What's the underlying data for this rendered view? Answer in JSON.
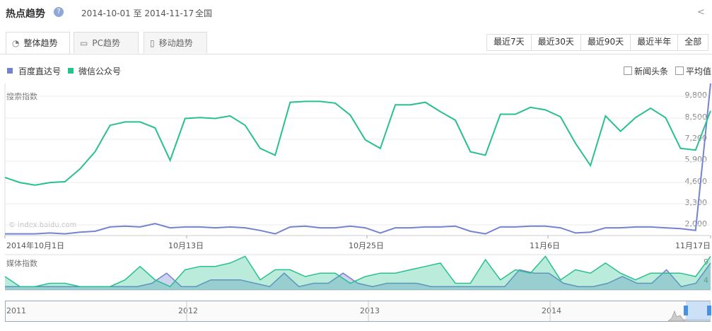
{
  "header": {
    "title": "热点趋势",
    "help": "?",
    "date_range": "2014-10-01 至 2014-11-17",
    "region": "全国",
    "share_icon": "share-icon"
  },
  "tabs": [
    {
      "label": "整体趋势",
      "icon": "pie-icon",
      "active": true
    },
    {
      "label": "PC趋势",
      "icon": "monitor-icon",
      "active": false
    },
    {
      "label": "移动趋势",
      "icon": "mobile-icon",
      "active": false
    }
  ],
  "ranges": [
    "最近7天",
    "最近30天",
    "最近90天",
    "最近半年",
    "全部"
  ],
  "legend": {
    "series": [
      {
        "label": "百度直达号",
        "color": "#7483d0"
      },
      {
        "label": "微信公众号",
        "color": "#27c08e"
      }
    ],
    "options": [
      "新闻头条",
      "平均值"
    ]
  },
  "search_chart": {
    "label": "搜索指数",
    "yticks": [
      "9,800",
      "8,500",
      "7,200",
      "5,900",
      "4,600",
      "3,300",
      "2,000"
    ],
    "watermark": "© index.baidu.com",
    "xticks": [
      "2014年10月1日",
      "10月13日",
      "10月25日",
      "11月6日",
      "11月17日"
    ]
  },
  "media_chart": {
    "label": "媒体指数",
    "yticks": [
      "9",
      "4"
    ]
  },
  "navigator": {
    "years": [
      "2011",
      "2012",
      "2013",
      "2014"
    ]
  },
  "chart_data": {
    "type": "line",
    "x": [
      "2014-10-01",
      "2014-10-02",
      "2014-10-03",
      "2014-10-04",
      "2014-10-05",
      "2014-10-06",
      "2014-10-07",
      "2014-10-08",
      "2014-10-09",
      "2014-10-10",
      "2014-10-11",
      "2014-10-12",
      "2014-10-13",
      "2014-10-14",
      "2014-10-15",
      "2014-10-16",
      "2014-10-17",
      "2014-10-18",
      "2014-10-19",
      "2014-10-20",
      "2014-10-21",
      "2014-10-22",
      "2014-10-23",
      "2014-10-24",
      "2014-10-25",
      "2014-10-26",
      "2014-10-27",
      "2014-10-28",
      "2014-10-29",
      "2014-10-30",
      "2014-10-31",
      "2014-11-01",
      "2014-11-02",
      "2014-11-03",
      "2014-11-04",
      "2014-11-05",
      "2014-11-06",
      "2014-11-07",
      "2014-11-08",
      "2014-11-09",
      "2014-11-10",
      "2014-11-11",
      "2014-11-12",
      "2014-11-13",
      "2014-11-14",
      "2014-11-15",
      "2014-11-16",
      "2014-11-17"
    ],
    "series": [
      {
        "name": "百度直达号",
        "values": [
          1500,
          1500,
          1500,
          1550,
          1500,
          1600,
          1650,
          1900,
          1950,
          1900,
          2100,
          1850,
          1900,
          1900,
          1850,
          1900,
          1850,
          1700,
          1500,
          1900,
          1950,
          1850,
          1850,
          1950,
          1850,
          1550,
          1850,
          1850,
          1900,
          1900,
          1950,
          1650,
          1500,
          1900,
          1900,
          1950,
          1950,
          1850,
          1550,
          1600,
          1850,
          1850,
          1900,
          1900,
          1850,
          1800,
          1700,
          10300
        ]
      },
      {
        "name": "微信公众号",
        "values": [
          4800,
          4500,
          4350,
          4500,
          4550,
          5300,
          6300,
          7850,
          8050,
          8050,
          7700,
          5800,
          8250,
          8300,
          8250,
          8400,
          7850,
          6500,
          6100,
          9200,
          9250,
          9250,
          9150,
          8450,
          7000,
          6500,
          9050,
          9050,
          9200,
          8650,
          8150,
          6300,
          6100,
          8500,
          8500,
          8900,
          8750,
          8350,
          6800,
          5500,
          8400,
          7500,
          8300,
          8850,
          8300,
          6500,
          6400,
          8700
        ]
      }
    ],
    "ylim": [
      1400,
      10300
    ],
    "media": {
      "series": [
        {
          "name": "百度直达号",
          "values": [
            1,
            1,
            1,
            1,
            1,
            1,
            1,
            1,
            1,
            1,
            2,
            5,
            1,
            1,
            3,
            3,
            3,
            2,
            1,
            5,
            1,
            2,
            2,
            5,
            2,
            1,
            2,
            2,
            2,
            1,
            1,
            1,
            1,
            1,
            1,
            6,
            5,
            5,
            2,
            1,
            1,
            2,
            4,
            2,
            2,
            6,
            1,
            2,
            8
          ]
        },
        {
          "name": "微信公众号",
          "values": [
            4,
            1,
            1,
            2,
            2,
            1,
            1,
            1,
            3,
            7,
            3,
            1,
            6,
            7,
            7,
            8,
            10,
            3,
            6,
            6,
            4,
            5,
            5,
            2,
            4,
            5,
            5,
            6,
            7,
            8,
            2,
            2,
            9,
            3,
            6,
            5,
            10,
            3,
            6,
            5,
            8,
            5,
            3,
            5,
            5,
            5,
            4,
            10
          ]
        }
      ],
      "ylim": [
        0,
        10.5
      ]
    }
  }
}
